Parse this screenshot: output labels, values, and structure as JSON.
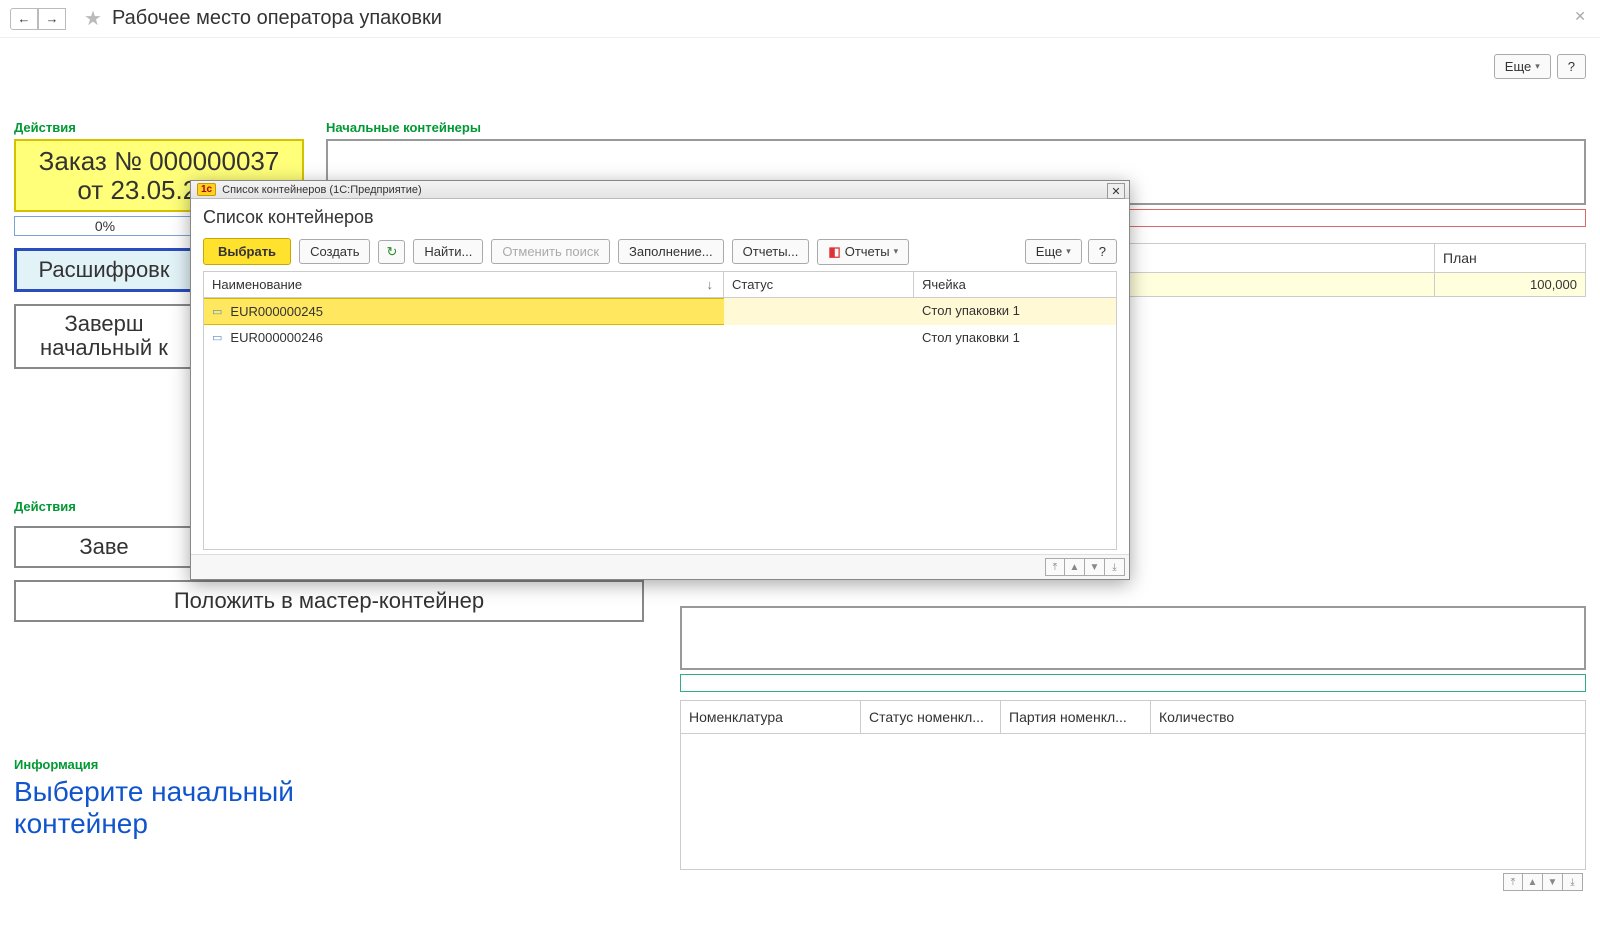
{
  "header": {
    "page_title": "Рабочее место оператора упаковки",
    "more": "Еще",
    "help": "?"
  },
  "labels": {
    "actions": "Действия",
    "initial": "Начальные контейнеры",
    "info": "Информация"
  },
  "order": {
    "line1": "Заказ № 000000037",
    "line2": "от 23.05.2019"
  },
  "progress": "0%",
  "buttons": {
    "decode": "Расшифровк",
    "finish_pick": "Заверш\nначальный к",
    "finish": "Заве",
    "put_master": "Положить в мастер-контейнер"
  },
  "plan": {
    "col_name": "",
    "col_plan": "План",
    "value": "100,000"
  },
  "items_table": {
    "c1": "Номенклатура",
    "c2": "Статус номенкл...",
    "c3": "Партия номенкл...",
    "c4": "Количество"
  },
  "info_text": "Выберите начальный контейнер",
  "modal": {
    "titlebar": "Список контейнеров  (1С:Предприятие)",
    "heading": "Список контейнеров",
    "toolbar": {
      "select": "Выбрать",
      "create": "Создать",
      "find": "Найти...",
      "cancel_find": "Отменить поиск",
      "fill": "Заполнение...",
      "reports1": "Отчеты...",
      "reports2": "Отчеты",
      "more": "Еще",
      "help": "?"
    },
    "columns": {
      "name": "Наименование",
      "status": "Статус",
      "cell": "Ячейка"
    },
    "rows": [
      {
        "name": "EUR000000245",
        "status": "",
        "cell": "Стол упаковки 1"
      },
      {
        "name": "EUR000000246",
        "status": "",
        "cell": "Стол упаковки 1"
      }
    ]
  }
}
